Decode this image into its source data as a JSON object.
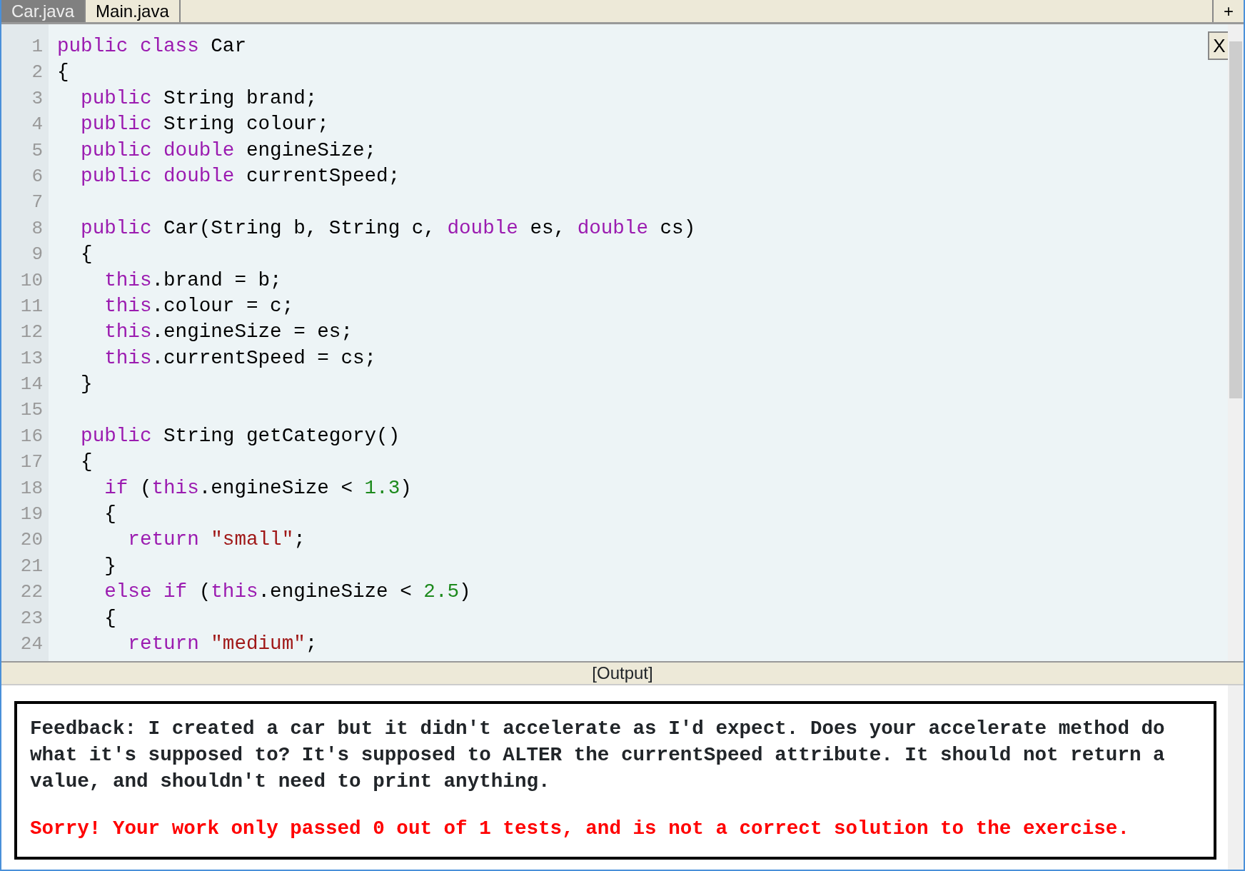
{
  "tabs": [
    {
      "label": "Car.java",
      "selected": true
    },
    {
      "label": "Main.java",
      "selected": false
    }
  ],
  "add_tab_button": "+",
  "close_button": "X",
  "code_lines": [
    {
      "number": "1",
      "tokens": [
        {
          "kind": "keyword",
          "text": "public class"
        },
        {
          "kind": "plain",
          "text": " Car"
        }
      ]
    },
    {
      "number": "2",
      "tokens": [
        {
          "kind": "plain",
          "text": "{"
        }
      ]
    },
    {
      "number": "3",
      "tokens": [
        {
          "kind": "keyword",
          "text": "  public"
        },
        {
          "kind": "plain",
          "text": " String brand;"
        }
      ]
    },
    {
      "number": "4",
      "tokens": [
        {
          "kind": "keyword",
          "text": "  public"
        },
        {
          "kind": "plain",
          "text": " String colour;"
        }
      ]
    },
    {
      "number": "5",
      "tokens": [
        {
          "kind": "keyword",
          "text": "  public double"
        },
        {
          "kind": "plain",
          "text": " engineSize;"
        }
      ]
    },
    {
      "number": "6",
      "tokens": [
        {
          "kind": "keyword",
          "text": "  public double"
        },
        {
          "kind": "plain",
          "text": " currentSpeed;"
        }
      ]
    },
    {
      "number": "7"
    },
    {
      "number": "8",
      "tokens": [
        {
          "kind": "keyword",
          "text": "  public"
        },
        {
          "kind": "plain",
          "text": " Car(String b, String c, "
        },
        {
          "kind": "keyword",
          "text": "double"
        },
        {
          "kind": "plain",
          "text": " es, "
        },
        {
          "kind": "keyword",
          "text": "double"
        },
        {
          "kind": "plain",
          "text": " cs)"
        }
      ]
    },
    {
      "number": "9",
      "tokens": [
        {
          "kind": "plain",
          "text": "  {"
        }
      ]
    },
    {
      "number": "10",
      "tokens": [
        {
          "kind": "keyword",
          "text": "    this"
        },
        {
          "kind": "plain",
          "text": ".brand = b;"
        }
      ]
    },
    {
      "number": "11",
      "tokens": [
        {
          "kind": "keyword",
          "text": "    this"
        },
        {
          "kind": "plain",
          "text": ".colour = c;"
        }
      ]
    },
    {
      "number": "12",
      "tokens": [
        {
          "kind": "keyword",
          "text": "    this"
        },
        {
          "kind": "plain",
          "text": ".engineSize = es;"
        }
      ]
    },
    {
      "number": "13",
      "tokens": [
        {
          "kind": "keyword",
          "text": "    this"
        },
        {
          "kind": "plain",
          "text": ".currentSpeed = cs;"
        }
      ]
    },
    {
      "number": "14",
      "tokens": [
        {
          "kind": "plain",
          "text": "  }"
        }
      ]
    },
    {
      "number": "15"
    },
    {
      "number": "16",
      "tokens": [
        {
          "kind": "keyword",
          "text": "  public"
        },
        {
          "kind": "plain",
          "text": " String getCategory()"
        }
      ]
    },
    {
      "number": "17",
      "tokens": [
        {
          "kind": "plain",
          "text": "  {"
        }
      ]
    },
    {
      "number": "18",
      "tokens": [
        {
          "kind": "keyword",
          "text": "    if"
        },
        {
          "kind": "plain",
          "text": " ("
        },
        {
          "kind": "keyword",
          "text": "this"
        },
        {
          "kind": "plain",
          "text": ".engineSize < "
        },
        {
          "kind": "number",
          "text": "1.3"
        },
        {
          "kind": "plain",
          "text": ")"
        }
      ]
    },
    {
      "number": "19",
      "tokens": [
        {
          "kind": "plain",
          "text": "    {"
        }
      ]
    },
    {
      "number": "20",
      "tokens": [
        {
          "kind": "keyword",
          "text": "      return"
        },
        {
          "kind": "string",
          "text": " \"small\""
        },
        {
          "kind": "plain",
          "text": ";"
        }
      ]
    },
    {
      "number": "21",
      "tokens": [
        {
          "kind": "plain",
          "text": "    }"
        }
      ]
    },
    {
      "number": "22",
      "tokens": [
        {
          "kind": "keyword",
          "text": "    else if"
        },
        {
          "kind": "plain",
          "text": " ("
        },
        {
          "kind": "keyword",
          "text": "this"
        },
        {
          "kind": "plain",
          "text": ".engineSize < "
        },
        {
          "kind": "number",
          "text": "2.5"
        },
        {
          "kind": "plain",
          "text": ")"
        }
      ]
    },
    {
      "number": "23",
      "tokens": [
        {
          "kind": "plain",
          "text": "    {"
        }
      ]
    },
    {
      "number": "24",
      "tokens": [
        {
          "kind": "keyword",
          "text": "      return"
        },
        {
          "kind": "string",
          "text": " \"medium\""
        },
        {
          "kind": "plain",
          "text": ";"
        }
      ]
    }
  ],
  "output_title": "[Output]",
  "feedback": {
    "message": "Feedback: I created a car but it didn't accelerate as I'd expect. Does your accelerate method do what it's supposed to? It's supposed to ALTER the currentSpeed attribute. It should not return a value, and shouldn't need to print anything.",
    "result": "Sorry! Your work only passed 0 out of 1 tests, and is not a correct solution to the exercise."
  }
}
